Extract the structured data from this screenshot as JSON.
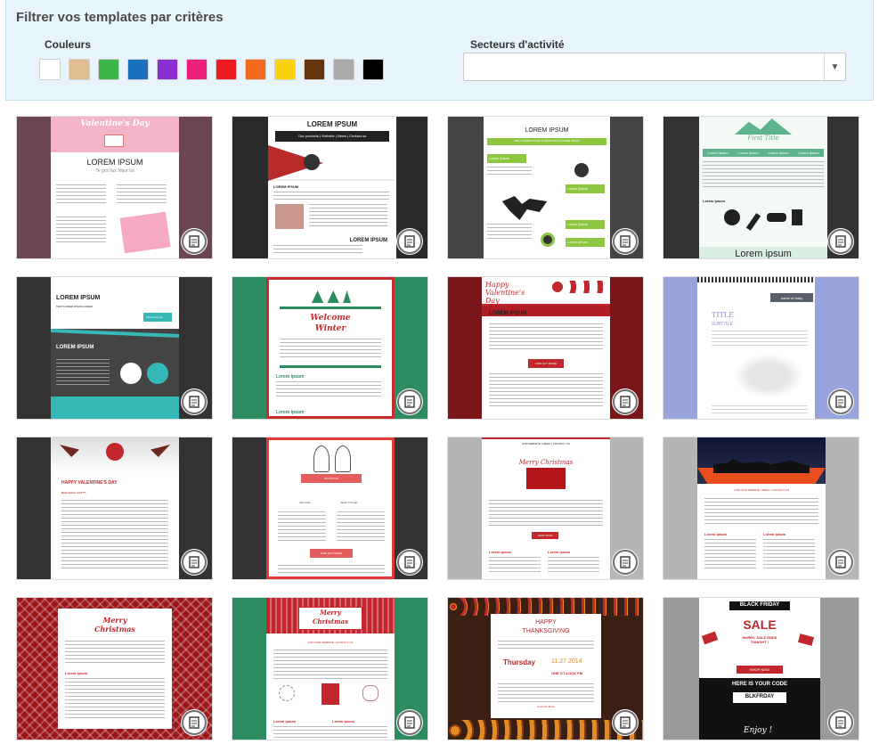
{
  "filter": {
    "title": "Filtrer vos templates par critères",
    "colors_label": "Couleurs",
    "colors": [
      "#ffffff",
      "#e3bd92",
      "#3cb54a",
      "#1a72bf",
      "#8b2fd1",
      "#ec1f7c",
      "#ed1c24",
      "#f46a1c",
      "#fbd213",
      "#64350f",
      "#aaaaaa",
      "#000000"
    ],
    "sectors_label": "Secteurs d'activité",
    "sectors_value": ""
  },
  "templates": {
    "t1": {
      "title": "Valentine's Day",
      "heading": "LOREM IPSUM",
      "sub": "Te gris llux fribur bo"
    },
    "t2": {
      "title": "LOREM IPSUM",
      "nav": "Our products | Website | News | Contact us",
      "heading": "LOREM IPSUM",
      "footer": "LOREM IPSUM"
    },
    "t3": {
      "title": "LOREM IPSUM",
      "bar": "TEXT LOREM IPSUM LOREM IPSUM LOREM IPSUM",
      "btn1": "Lorem ipsum",
      "btn2": "Lorem ipsum",
      "btn3": "Lorem ipsum",
      "btn4": "Lorem ipsum"
    },
    "t4": {
      "title": "First Title",
      "col1": "Lorem ipsum",
      "col2": "Lorem ipsum",
      "col3": "Lorem ipsum",
      "col4": "Lorem ipsum",
      "label": "Lorem ipsum",
      "footer": "Lorem ipsum"
    },
    "t5": {
      "title": "LOREM IPSUM",
      "sub": "TEXT LOREM IPSUM LOREM",
      "btn": "Find out more",
      "heading2": "LOREM IPSUM"
    },
    "t6": {
      "title1": "Welcome",
      "title2": "Winter",
      "section1": "Lorem ipsum",
      "section2": "Lorem ipsum"
    },
    "t7": {
      "title": "Happy Valentine's Day",
      "heading": "LOREM IPSUM",
      "btn": "FIND OUT MORE"
    },
    "t8": {
      "badge": "name of baby",
      "title": "TITLE",
      "subtitle": "SUBTITLE"
    },
    "t9": {
      "title": "HAPPY VALENTINE'S DAY",
      "sub": "Dear Futurs Ch???,"
    },
    "t10": {
      "banner": "INVITATION",
      "name1": "John Doe",
      "name2": "Sarah Thomas",
      "btn": "FIND OUT MORE"
    },
    "t11": {
      "nav": "OUR WEBSITE | MENU | CONTACT US",
      "title": "Merry Christmas",
      "btn": "SHOP NOW",
      "col1": "Lorem ipsum",
      "col2": "Lorem ipsum"
    },
    "t12": {
      "nav": "VISIT OUR WEBSITE | MENU | CONTACT US",
      "col1": "Lorem ipsum",
      "col2": "Lorem ipsum"
    },
    "t13": {
      "title1": "Merry",
      "title2": "Christmas",
      "section": "Lorem ipsum"
    },
    "t14": {
      "title1": "Merry",
      "title2": "Christmas",
      "nav": "VISIT OUR WEBSITE | CONTACT US",
      "col1": "Lorem ipsum",
      "col2": "Lorem ipsum"
    },
    "t15": {
      "title1": "HAPPY",
      "title2": "THANKSGIVING",
      "day": "Thursday",
      "date": "11.27.2014",
      "time": "ONE O'CLOCK PM",
      "link": "Find Out More"
    },
    "t16": {
      "badge": "BLACK FRIDAY",
      "title": "SALE",
      "sub": "HURRY, SALE ENDS TONIGHT !",
      "btn": "SHOP NOW",
      "code_label": "HERE IS YOUR CODE",
      "code": "BLKFRDAY",
      "sign": "Enjoy !"
    }
  }
}
